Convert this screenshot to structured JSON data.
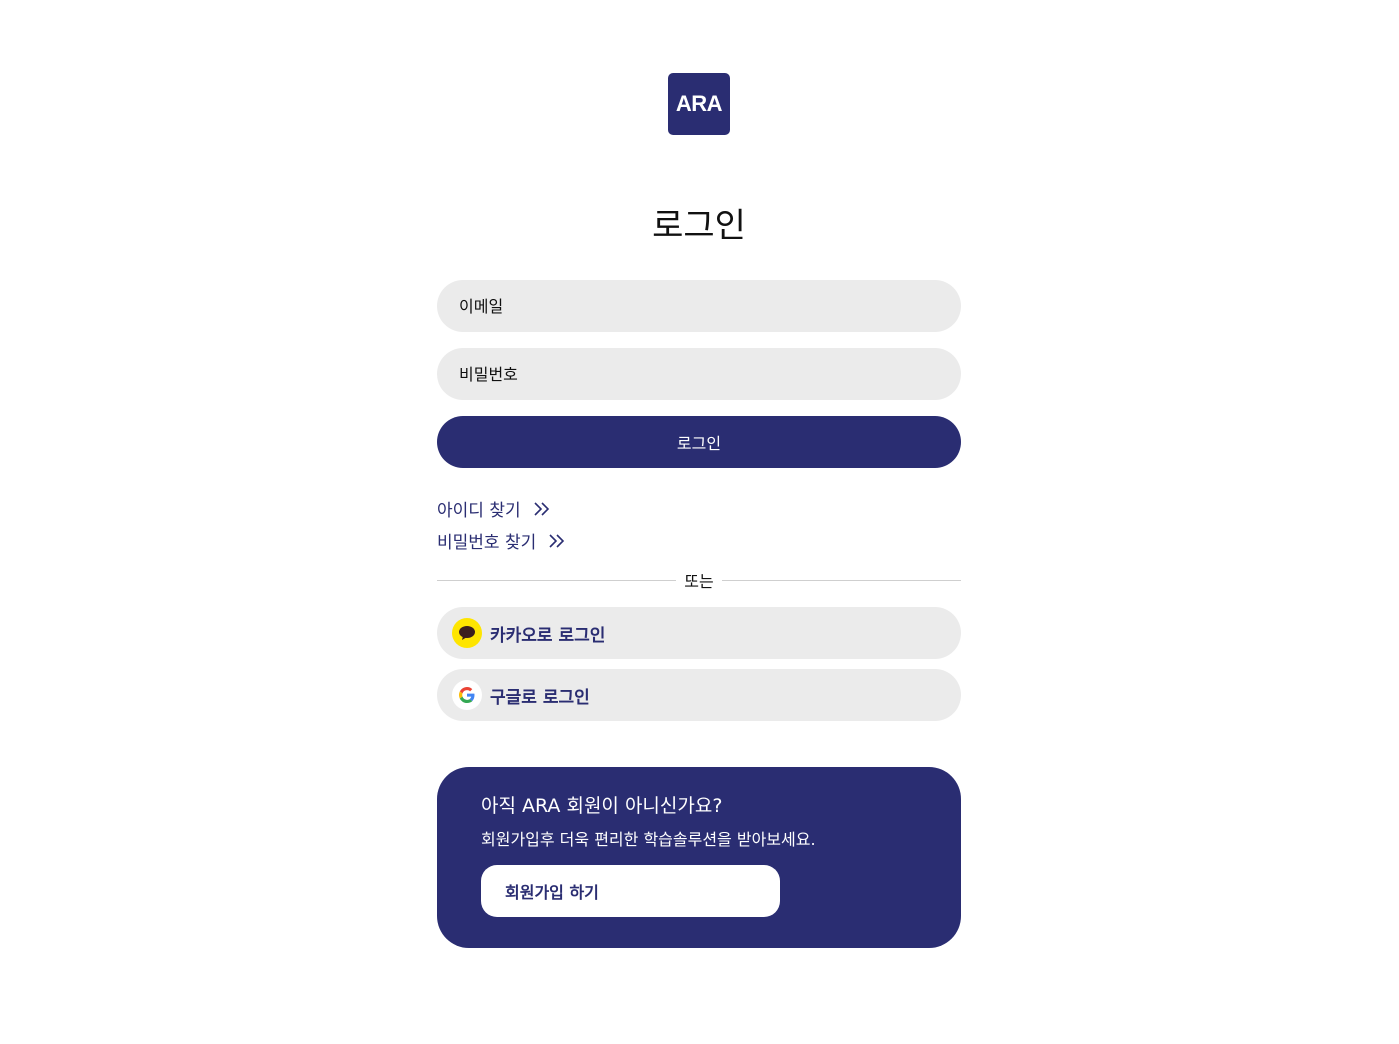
{
  "colors": {
    "brand": "#2a2d72",
    "field_bg": "#ebebeb",
    "kakao_yellow": "#fee500",
    "kakao_bubble": "#3b1f1e",
    "link": "#2a2d72"
  },
  "logo": {
    "text": "ARA"
  },
  "page": {
    "title": "로그인"
  },
  "form": {
    "email_placeholder": "이메일",
    "password_placeholder": "비밀번호",
    "submit_label": "로그인"
  },
  "links": {
    "find_id": {
      "label": "아이디 찾기",
      "icon": "double-chevron-right-icon"
    },
    "find_password": {
      "label": "비밀번호 찾기",
      "icon": "double-chevron-right-icon"
    }
  },
  "divider": {
    "label": "또는"
  },
  "social": {
    "kakao": {
      "label": "카카오로 로그인",
      "icon": "kakao-icon"
    },
    "google": {
      "label": "구글로 로그인",
      "icon": "google-icon"
    }
  },
  "signup": {
    "heading": "아직 ARA 회원이 아니신가요?",
    "subtext": "회원가입후 더욱 편리한 학습솔루션을 받아보세요.",
    "button_label": "회원가입 하기"
  }
}
